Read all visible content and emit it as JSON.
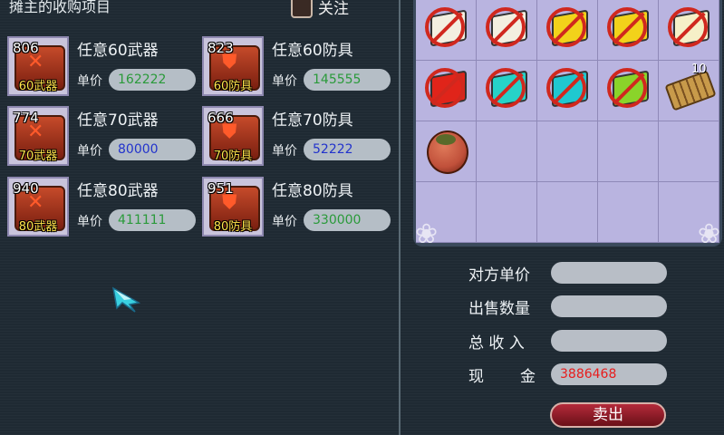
{
  "header": {
    "title": "摊主的收购项目",
    "follow_label": "关注"
  },
  "price_label": "单价",
  "purchase_items": [
    {
      "count": "806",
      "level_tag": "60武器",
      "name": "任意60武器",
      "price": "162222",
      "price_color": "green"
    },
    {
      "count": "823",
      "level_tag": "60防具",
      "name": "任意60防具",
      "price": "145555",
      "price_color": "green"
    },
    {
      "count": "774",
      "level_tag": "70武器",
      "name": "任意70武器",
      "price": "80000",
      "price_color": "blue"
    },
    {
      "count": "666",
      "level_tag": "70防具",
      "name": "任意70防具",
      "price": "52222",
      "price_color": "blue"
    },
    {
      "count": "940",
      "level_tag": "80武器",
      "name": "任意80武器",
      "price": "411111",
      "price_color": "green"
    },
    {
      "count": "951",
      "level_tag": "80防具",
      "name": "任意80防具",
      "price": "330000",
      "price_color": "green"
    }
  ],
  "inventory": {
    "slots": [
      {
        "icon": "white-flag-icon",
        "color": "#f3efe0",
        "forbidden": true
      },
      {
        "icon": "white-flag-icon",
        "color": "#f3efe0",
        "forbidden": true
      },
      {
        "icon": "yellow-flag-icon",
        "color": "#f2d21a",
        "forbidden": true
      },
      {
        "icon": "yellow-flag-icon",
        "color": "#f2d21a",
        "forbidden": true
      },
      {
        "icon": "white-flag-icon",
        "color": "#f6f0c8",
        "forbidden": true
      },
      {
        "icon": "red-flag-icon",
        "color": "#e0241a",
        "forbidden": true
      },
      {
        "icon": "cyan-flag-icon",
        "color": "#26d3c8",
        "forbidden": true
      },
      {
        "icon": "cyan-flag-icon",
        "color": "#1fc8d0",
        "forbidden": true
      },
      {
        "icon": "green-flag-icon",
        "color": "#8ad42a",
        "forbidden": true
      },
      {
        "icon": "scroll-bundle-icon",
        "color": "#c89a4a",
        "forbidden": false,
        "count": "10"
      },
      {
        "icon": "treasure-pouch-icon",
        "color": "#c0503a",
        "forbidden": false
      },
      null,
      null,
      null,
      null,
      null,
      null,
      null,
      null,
      null
    ]
  },
  "trade_form": {
    "unit_price_label": "对方单价",
    "quantity_label": "出售数量",
    "total_label": "总 收 入",
    "cash_label": "现",
    "cash_label2": "金",
    "cash_value": "3886468",
    "sell_label": "卖出"
  },
  "colors": {
    "green_price": "#2a9a3a",
    "blue_price": "#2233cc",
    "cash": "#e81c1c"
  }
}
